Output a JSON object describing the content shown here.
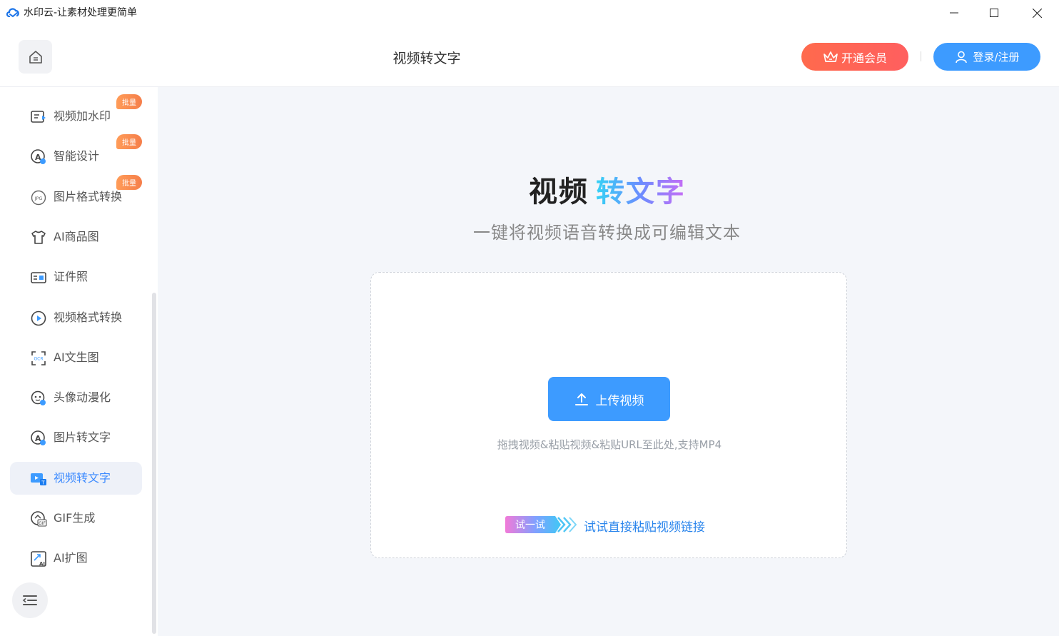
{
  "window": {
    "title": "水印云-让素材处理更简单"
  },
  "header": {
    "page_title": "视频转文字",
    "vip_label": "开通会员",
    "login_label": "登录/注册"
  },
  "sidebar": {
    "items": [
      {
        "label": "视频加水印",
        "icon": "video-watermark-icon",
        "badge": "批量",
        "active": false
      },
      {
        "label": "智能设计",
        "icon": "smart-design-icon",
        "badge": "批量",
        "active": false
      },
      {
        "label": "图片格式转换",
        "icon": "jpg-format-icon",
        "badge": "批量",
        "active": false
      },
      {
        "label": "AI商品图",
        "icon": "tshirt-icon",
        "badge": "",
        "active": false
      },
      {
        "label": "证件照",
        "icon": "id-card-icon",
        "badge": "",
        "active": false
      },
      {
        "label": "视频格式转换",
        "icon": "play-circle-icon",
        "badge": "",
        "active": false
      },
      {
        "label": "AI文生图",
        "icon": "ocr-scan-icon",
        "badge": "",
        "active": false
      },
      {
        "label": "头像动漫化",
        "icon": "avatar-anime-icon",
        "badge": "",
        "active": false
      },
      {
        "label": "图片转文字",
        "icon": "image-text-icon",
        "badge": "",
        "active": false
      },
      {
        "label": "视频转文字",
        "icon": "video-text-icon",
        "badge": "",
        "active": true
      },
      {
        "label": "GIF生成",
        "icon": "gif-icon",
        "badge": "",
        "active": false
      },
      {
        "label": "AI扩图",
        "icon": "ai-expand-icon",
        "badge": "",
        "active": false
      }
    ]
  },
  "main": {
    "title_part1": "视频",
    "title_part2": "转文字",
    "subtitle": "一键将视频语音转换成可编辑文本",
    "upload_label": "上传视频",
    "hint": "拖拽视频&粘贴视频&粘贴URL至此处,支持MP4",
    "try_badge": "试一试",
    "try_link": "试试直接粘贴视频链接"
  },
  "colors": {
    "accent": "#3d9bff",
    "vip": "#ff6a4d",
    "badge": "#f7874d",
    "main_bg": "#f4f6fa"
  }
}
